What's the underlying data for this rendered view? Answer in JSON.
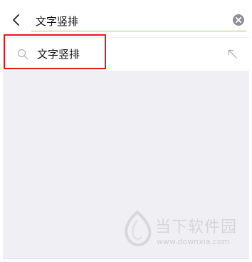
{
  "search": {
    "query": "文字竖排",
    "accent_color": "#9ccc65"
  },
  "suggestions": [
    {
      "label": "文字竖排"
    }
  ],
  "highlight": {
    "color": "#e8161a"
  },
  "watermark": {
    "name": "当下软件园",
    "url": "www.downxia.com"
  },
  "icons": {
    "back": "chevron-left-icon",
    "clear": "clear-circle-icon",
    "search": "search-icon",
    "fill": "arrow-up-left-icon"
  }
}
